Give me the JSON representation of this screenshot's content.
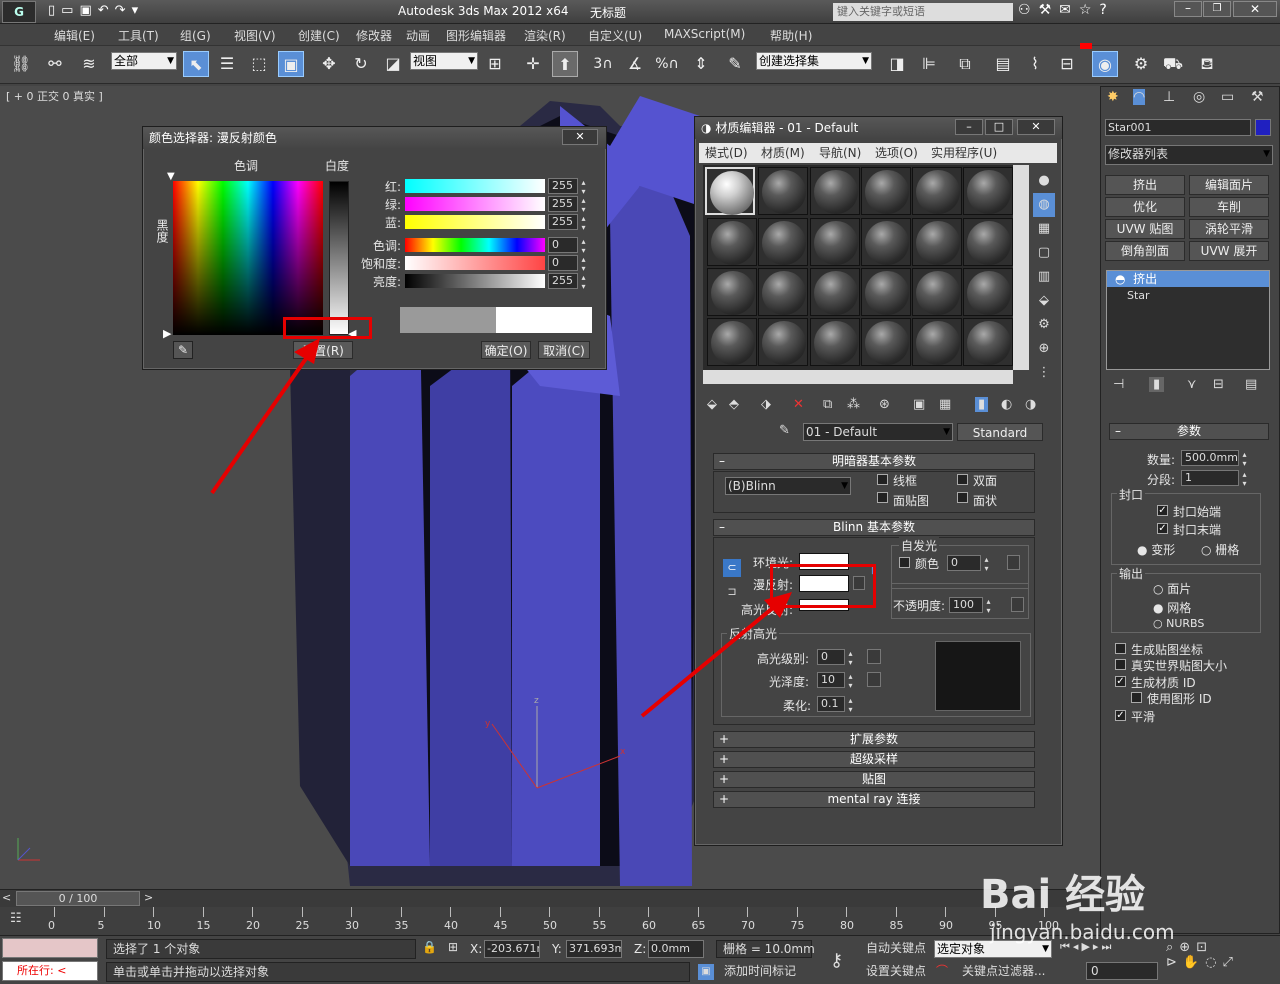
{
  "app": {
    "title": "Autodesk 3ds Max  2012 x64",
    "doc": "无标题",
    "search_placeholder": "键入关键字或短语"
  },
  "menu": [
    "编辑(E)",
    "工具(T)",
    "组(G)",
    "视图(V)",
    "创建(C)",
    "修改器",
    "动画",
    "图形编辑器",
    "渲染(R)",
    "自定义(U)",
    "MAXScript(M)",
    "帮助(H)"
  ],
  "toolbar": {
    "filter": "全部",
    "ref_coord": "视图",
    "named_sel": "创建选择集",
    "snap3": "3",
    "snap_pct": "%"
  },
  "viewport": {
    "label": "[ + 0 正交 0 真实 ]"
  },
  "color_picker": {
    "title": "颜色选择器: 漫反射颜色",
    "hue_label": "色调",
    "white_label": "白度",
    "black_label": "黑度",
    "rows": [
      {
        "label": "红:",
        "value": "255"
      },
      {
        "label": "绿:",
        "value": "255"
      },
      {
        "label": "蓝:",
        "value": "255"
      },
      {
        "label": "色调:",
        "value": "0"
      },
      {
        "label": "饱和度:",
        "value": "0"
      },
      {
        "label": "亮度:",
        "value": "255"
      }
    ],
    "reset": "重置(R)",
    "ok": "确定(O)",
    "cancel": "取消(C)"
  },
  "mat_editor": {
    "title": "材质编辑器 - 01 - Default",
    "menu": [
      "模式(D)",
      "材质(M)",
      "导航(N)",
      "选项(O)",
      "实用程序(U)"
    ],
    "mat_name": "01 - Default",
    "mat_type": "Standard",
    "shader_rollout": "明暗器基本参数",
    "shader": "(B)Blinn",
    "shader_opts": [
      "线框",
      "双面",
      "面贴图",
      "面状"
    ],
    "blinn_rollout": "Blinn 基本参数",
    "self_illum": "自发光",
    "color_chk": "颜色",
    "color_val": "0",
    "ambient": "环境光:",
    "diffuse": "漫反射:",
    "specular": "高光反射:",
    "opacity": "不透明度:",
    "opacity_val": "100",
    "spec_group": "反射高光",
    "spec_level": "高光级别:",
    "spec_level_val": "0",
    "gloss": "光泽度:",
    "gloss_val": "10",
    "soften": "柔化:",
    "soften_val": "0.1",
    "rollouts": [
      "扩展参数",
      "超级采样",
      "贴图",
      "mental ray 连接"
    ]
  },
  "cmd_panel": {
    "obj_name": "Star001",
    "mod_list": "修改器列表",
    "mod_buttons": [
      "挤出",
      "编辑面片",
      "优化",
      "车削",
      "UVW 贴图",
      "涡轮平滑",
      "倒角剖面",
      "UVW 展开"
    ],
    "stack": [
      "挤出",
      "Star"
    ],
    "params": "参数",
    "amount_label": "数量:",
    "amount": "500.0mm",
    "segments_label": "分段:",
    "segments": "1",
    "cap": "封口",
    "cap_start": "封口始端",
    "cap_end": "封口末端",
    "morph": "变形",
    "grid": "栅格",
    "output": "输出",
    "patch": "面片",
    "mesh": "网格",
    "nurbs": "NURBS",
    "opts": [
      "生成贴图坐标",
      "真实世界贴图大小",
      "生成材质 ID",
      "使用图形 ID",
      "平滑"
    ]
  },
  "timeline": {
    "frame": "0 / 100",
    "ticks": [
      "0",
      "5",
      "10",
      "15",
      "20",
      "25",
      "30",
      "35",
      "40",
      "45",
      "50",
      "55",
      "60",
      "65",
      "70",
      "75",
      "80",
      "85",
      "90",
      "95",
      "100"
    ]
  },
  "status": {
    "selected": "选择了 1 个对象",
    "prompt": "单击或单击并拖动以选择对象",
    "current": "所在行:",
    "x": "-203.671m",
    "y": "371.693mm",
    "z": "0.0mm",
    "grid": "栅格 = 10.0mm",
    "add_time_tag": "添加时间标记",
    "auto_key": "自动关键点",
    "set_key": "设置关键点",
    "sel_obj": "选定对象",
    "key_filter": "关键点过滤器...",
    "frame_val": "0"
  },
  "watermark": "jingyan.baidu.com",
  "watermark_brand": "Bai 经验"
}
